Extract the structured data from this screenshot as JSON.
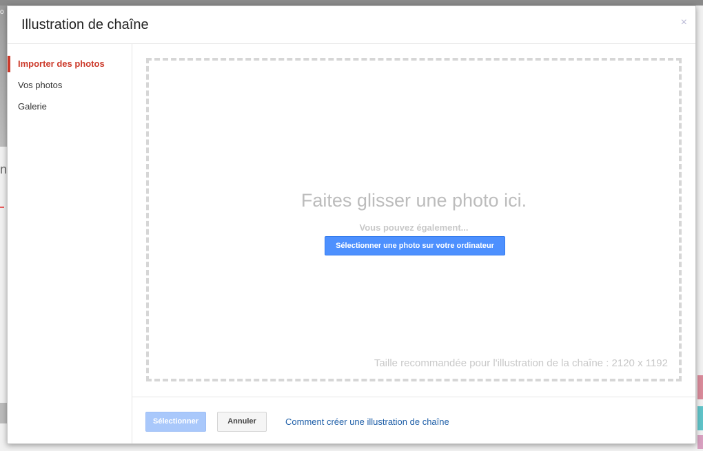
{
  "background": {
    "left_photo_text": "o",
    "left_letter": "n"
  },
  "dialog": {
    "title": "Illustration de chaîne",
    "close_glyph": "×"
  },
  "sidebar": {
    "items": [
      {
        "label": "Importer des photos",
        "active": true
      },
      {
        "label": "Vos photos",
        "active": false
      },
      {
        "label": "Galerie",
        "active": false
      }
    ]
  },
  "dropzone": {
    "heading": "Faites glisser une photo ici.",
    "subtext": "Vous pouvez également...",
    "upload_button_label": "Sélectionner une photo sur votre ordinateur",
    "hint": "Taille recommandée pour l'illustration de la chaîne : 2120 x 1192"
  },
  "footer": {
    "select_label": "Sélectionner",
    "cancel_label": "Annuler",
    "help_link": "Comment créer une illustration de chaîne"
  },
  "colors": {
    "accent_active": "#cc3a2b",
    "primary_button": "#4d90fe",
    "primary_button_disabled": "#a9c8fb",
    "link": "#1f5fa8"
  }
}
